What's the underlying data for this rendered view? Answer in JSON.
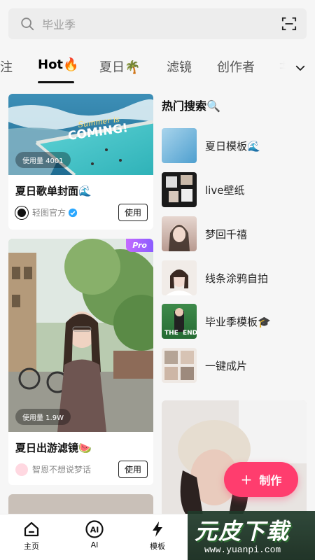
{
  "search": {
    "placeholder": "毕业季"
  },
  "tabs": {
    "items": [
      {
        "label": "注"
      },
      {
        "label": "Hot",
        "emoji": "🔥"
      },
      {
        "label": "夏日",
        "emoji": "🌴"
      },
      {
        "label": "滤镜"
      },
      {
        "label": "创作者"
      },
      {
        "label": "±"
      }
    ],
    "active": "Hot"
  },
  "cards": [
    {
      "title": "夏日歌单封面🌊",
      "image_text": "Summer is COMING!",
      "usage": "使用量 4001",
      "author": "轻图官方",
      "use_label": "使用"
    },
    {
      "title": "夏日出游滤镜🍉",
      "badge": "Pro",
      "usage": "使用量 1.9W",
      "author": "智恩不想说梦话",
      "use_label": "使用"
    }
  ],
  "hot_search": {
    "title": "热门搜索🔍",
    "items": [
      {
        "label": "夏日模板🌊"
      },
      {
        "label": "live壁纸"
      },
      {
        "label": "梦回千禧"
      },
      {
        "label": "线条涂鸦自拍"
      },
      {
        "label": "毕业季模板🎓"
      },
      {
        "label": "一键成片"
      }
    ]
  },
  "make_button": {
    "label": "制作"
  },
  "bottom_nav": {
    "items": [
      {
        "label": "主页",
        "icon": "home-icon"
      },
      {
        "label": "AI",
        "icon": "ai-icon"
      },
      {
        "label": "模板",
        "icon": "lightning-icon"
      }
    ]
  },
  "watermark": {
    "text": "元皮下载",
    "url": "www.yuanpi.com"
  },
  "colors": {
    "accent": "#ff3d6e",
    "verified": "#2aa7ff",
    "pro": "#a45bff"
  }
}
